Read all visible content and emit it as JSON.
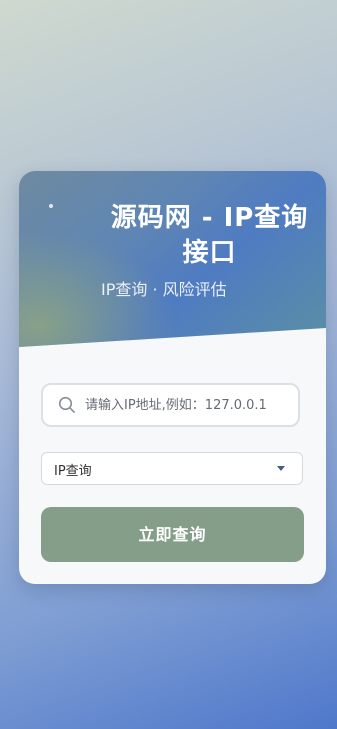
{
  "header": {
    "title": "源码网 - IP查询接口",
    "subtitle": "IP查询 · 风险评估"
  },
  "search": {
    "placeholder": "请输入IP地址,例如：127.0.0.1",
    "value": "",
    "icon": "search-icon"
  },
  "query_type": {
    "selected": "IP查询",
    "options": [
      "IP查询"
    ],
    "icon": "caret-down-icon"
  },
  "submit": {
    "label": "立即查询"
  },
  "colors": {
    "accent_button": "#859e8a",
    "header_blue": "#4f7bc2",
    "caret": "#3f5f86"
  }
}
